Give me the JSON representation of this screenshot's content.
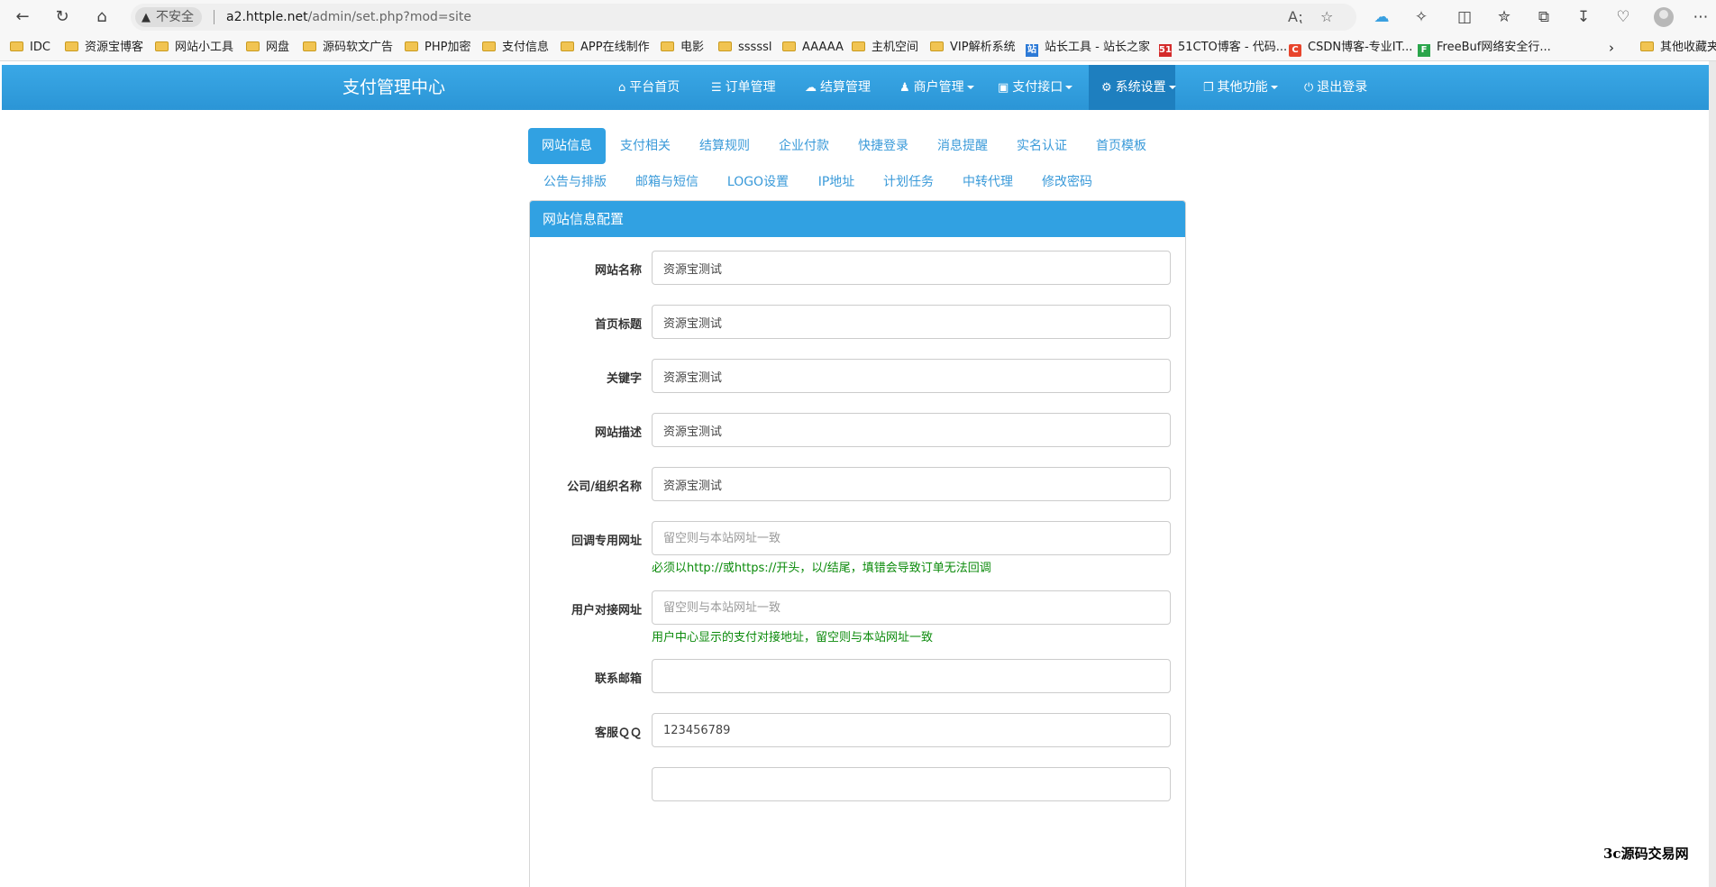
{
  "browser": {
    "security_label": "不安全",
    "url_host": "a2.httple.net",
    "url_path": "/admin/set.php?mod=site",
    "bookmarks": [
      {
        "label": "IDC"
      },
      {
        "label": "资源宝博客"
      },
      {
        "label": "网站小工具"
      },
      {
        "label": "网盘"
      },
      {
        "label": "源码软文广告"
      },
      {
        "label": "PHP加密"
      },
      {
        "label": "支付信息"
      },
      {
        "label": "APP在线制作"
      },
      {
        "label": "电影"
      },
      {
        "label": "sssssl"
      },
      {
        "label": "AAAAA"
      },
      {
        "label": "主机空间"
      },
      {
        "label": "VIP解析系统"
      },
      {
        "label": "站长工具 - 站长之家"
      },
      {
        "label": "51CTO博客 - 代码..."
      },
      {
        "label": "CSDN博客-专业IT..."
      },
      {
        "label": "FreeBuf网络安全行..."
      }
    ],
    "other_bookmarks": "其他收藏夹"
  },
  "app": {
    "brand": "支付管理中心",
    "nav": [
      {
        "label": "平台首页",
        "icon": "home-icon"
      },
      {
        "label": "订单管理",
        "icon": "list-icon"
      },
      {
        "label": "结算管理",
        "icon": "cloud-icon"
      },
      {
        "label": "商户管理",
        "icon": "user-icon"
      },
      {
        "label": "支付接口",
        "icon": "credit-card-icon"
      },
      {
        "label": "系统设置",
        "icon": "gear-icon"
      },
      {
        "label": "其他功能",
        "icon": "cube-icon"
      },
      {
        "label": "退出登录",
        "icon": "power-icon"
      }
    ]
  },
  "tabs": {
    "row1": [
      "网站信息",
      "支付相关",
      "结算规则",
      "企业付款",
      "快捷登录",
      "消息提醒",
      "实名认证",
      "首页模板"
    ],
    "row2": [
      "公告与排版",
      "邮箱与短信",
      "LOGO设置",
      "IP地址",
      "计划任务",
      "中转代理",
      "修改密码"
    ]
  },
  "panel": {
    "title": "网站信息配置",
    "fields": [
      {
        "label": "网站名称",
        "value": "资源宝测试",
        "placeholder": ""
      },
      {
        "label": "首页标题",
        "value": "资源宝测试",
        "placeholder": ""
      },
      {
        "label": "关键字",
        "value": "资源宝测试",
        "placeholder": ""
      },
      {
        "label": "网站描述",
        "value": "资源宝测试",
        "placeholder": ""
      },
      {
        "label": "公司/组织名称",
        "value": "资源宝测试",
        "placeholder": ""
      },
      {
        "label": "回调专用网址",
        "value": "",
        "placeholder": "留空则与本站网址一致",
        "help": "必须以http://或https://开头，以/结尾，填错会导致订单无法回调"
      },
      {
        "label": "用户对接网址",
        "value": "",
        "placeholder": "留空则与本站网址一致",
        "help": "用户中心显示的支付对接地址，留空则与本站网址一致"
      },
      {
        "label": "联系邮箱",
        "value": "",
        "placeholder": ""
      },
      {
        "label": "客服ＱＱ",
        "value": "123456789",
        "placeholder": ""
      }
    ]
  },
  "watermark": "3c源码交易网",
  "colors": {
    "navbar": "#2b95d6",
    "accent": "#31a1e2",
    "help_text": "#0a8a0a"
  }
}
